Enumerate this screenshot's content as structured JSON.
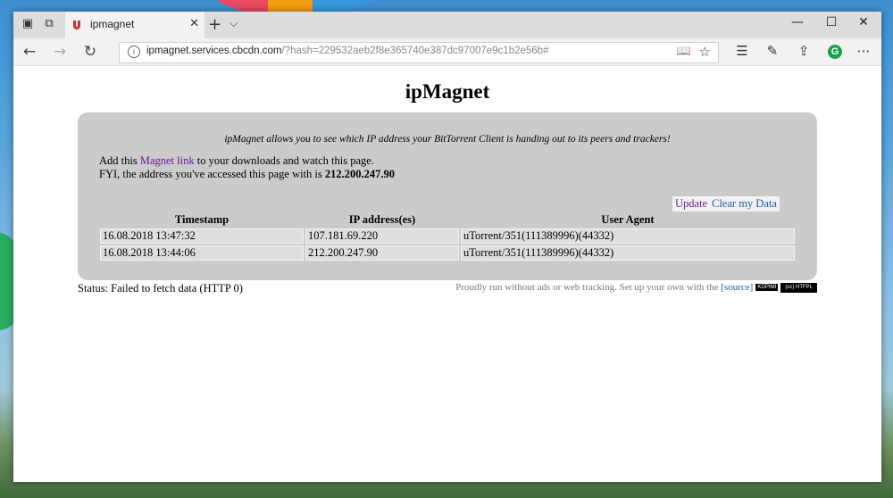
{
  "tab": {
    "title": "ipmagnet"
  },
  "address": {
    "host": "ipmagnet.services.cbcdn.com",
    "path": "/?hash=229532aeb2f8e365740e387dc97007e9c1b2e56b#"
  },
  "page": {
    "title": "ipMagnet",
    "intro": "ipMagnet allows you to see which IP address your BitTorrent Client is handing out to its peers and trackers!",
    "add_prefix": "Add this ",
    "magnet_link": "Magnet link",
    "add_suffix": " to your downloads and watch this page.",
    "fyi_prefix": "FYI, the address you've accessed this page with is ",
    "fyi_ip": "212.200.247.90",
    "update_button": "Update",
    "clear_button": "Clear my Data",
    "table": {
      "headers": [
        "Timestamp",
        "IP address(es)",
        "User Agent"
      ],
      "rows": [
        [
          "16.08.2018 13:47:32",
          "107.181.69.220",
          "uTorrent/351(111389996)(44332)"
        ],
        [
          "16.08.2018 13:44:06",
          "212.200.247.90",
          "uTorrent/351(111389996)(44332)"
        ]
      ]
    },
    "status": "Status: Failed to fetch data (HTTP 0)",
    "footer_text": "Proudly run without ads or web tracking. Set up your own with the ",
    "source_link": "[source]",
    "badge1": "KOPIMI",
    "badge2": "(cc) HTFPL"
  },
  "colors": {
    "panel": "#cbcbcb",
    "link_purple": "#6a1b9a",
    "link_blue": "#1e5aa8"
  }
}
